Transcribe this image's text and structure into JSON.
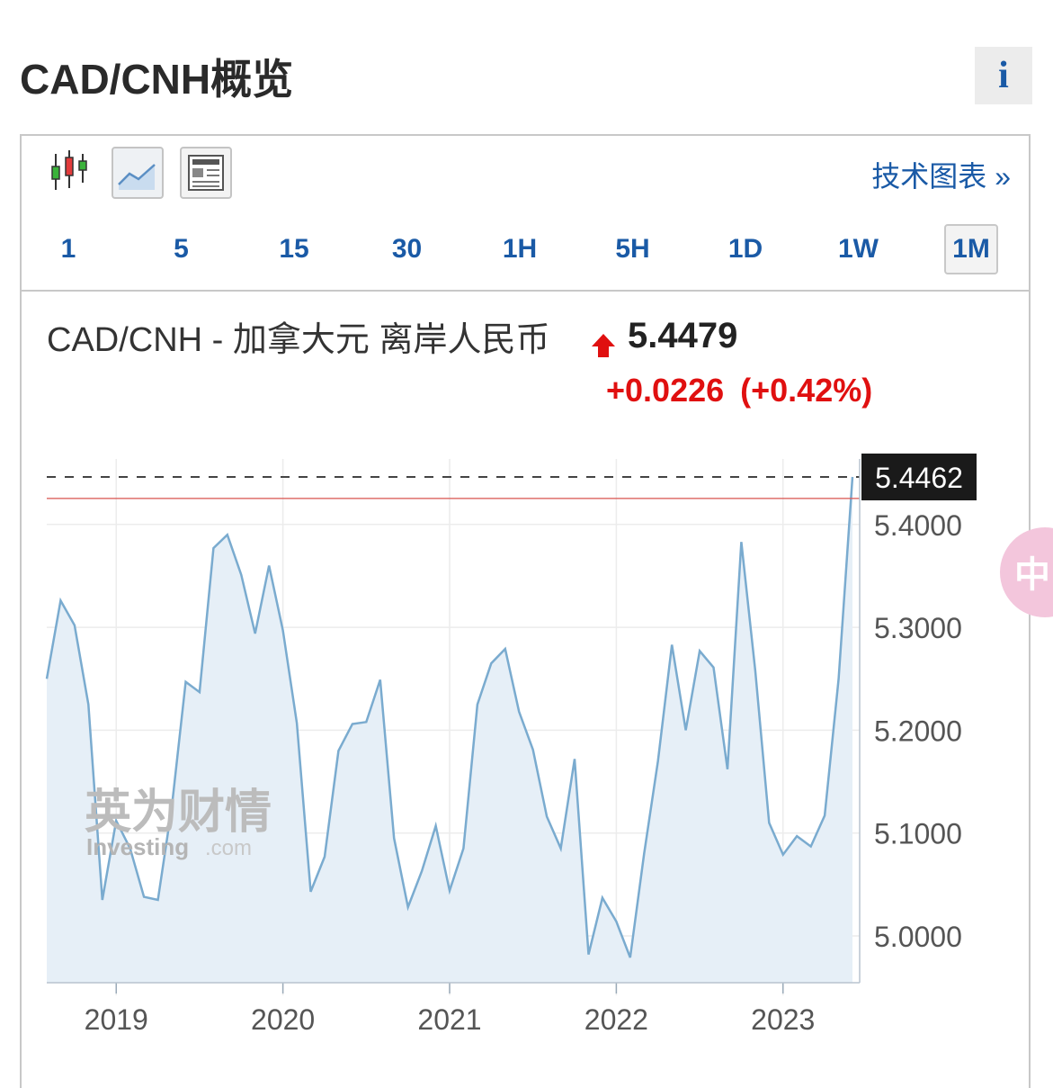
{
  "page": {
    "title": "CAD/CNH概览",
    "info_label": "i"
  },
  "toolbar": {
    "chart_types": [
      {
        "name": "candlestick-chart-icon",
        "active": false
      },
      {
        "name": "area-chart-icon",
        "active": true
      },
      {
        "name": "overview-table-icon",
        "active": false
      }
    ],
    "tech_link": "技术图表 »"
  },
  "timeframes": [
    {
      "label": "1",
      "active": false
    },
    {
      "label": "5",
      "active": false
    },
    {
      "label": "15",
      "active": false
    },
    {
      "label": "30",
      "active": false
    },
    {
      "label": "1H",
      "active": false
    },
    {
      "label": "5H",
      "active": false
    },
    {
      "label": "1D",
      "active": false
    },
    {
      "label": "1W",
      "active": false
    },
    {
      "label": "1M",
      "active": true
    }
  ],
  "instrument": {
    "name": "CAD/CNH - 加拿大元 离岸人民币",
    "last_price": "5.4479",
    "change": "+0.0226",
    "change_pct": "(+0.42%)",
    "direction": "up"
  },
  "watermark": {
    "brand": "英为财情",
    "sub": "Investing",
    "domain": ".com"
  },
  "side_badge": "中",
  "colors": {
    "link": "#1a5aa6",
    "up": "#e01010",
    "line": "#7aabcf",
    "area_fill": "#e6eff7",
    "ref_line": "#d9534f",
    "label_bg": "#1a1a1a"
  },
  "chart_data": {
    "type": "area",
    "title": "",
    "xlabel": "",
    "ylabel": "",
    "x_ticks": [
      "2019",
      "2020",
      "2021",
      "2022",
      "2023"
    ],
    "y_ticks": [
      "5.0000",
      "5.1000",
      "5.2000",
      "5.3000",
      "5.4000"
    ],
    "ylim": [
      4.96,
      5.47
    ],
    "current_value": 5.4462,
    "current_label": "5.4462",
    "reference_value": 5.4253,
    "grid": true,
    "series": [
      {
        "x": [
          "2018-08",
          "2018-09",
          "2018-10",
          "2018-11",
          "2018-12",
          "2019-01",
          "2019-02",
          "2019-03",
          "2019-04",
          "2019-05",
          "2019-06",
          "2019-07",
          "2019-08",
          "2019-09",
          "2019-10",
          "2019-11",
          "2019-12",
          "2020-01",
          "2020-02",
          "2020-03",
          "2020-04",
          "2020-05",
          "2020-06",
          "2020-07",
          "2020-08",
          "2020-09",
          "2020-10",
          "2020-11",
          "2020-12",
          "2021-01",
          "2021-02",
          "2021-03",
          "2021-04",
          "2021-05",
          "2021-06",
          "2021-07",
          "2021-08",
          "2021-09",
          "2021-10",
          "2021-11",
          "2021-12",
          "2022-01",
          "2022-02",
          "2022-03",
          "2022-04",
          "2022-05",
          "2022-06",
          "2022-07",
          "2022-08",
          "2022-09",
          "2022-10",
          "2022-11",
          "2022-12",
          "2023-01",
          "2023-02",
          "2023-03",
          "2023-04",
          "2023-05",
          "2023-06"
        ],
        "values": [
          5.25,
          5.326,
          5.302,
          5.225,
          5.035,
          5.112,
          5.085,
          5.038,
          5.035,
          5.125,
          5.247,
          5.237,
          5.377,
          5.39,
          5.351,
          5.294,
          5.36,
          5.297,
          5.207,
          5.043,
          5.077,
          5.18,
          5.206,
          5.208,
          5.249,
          5.095,
          5.028,
          5.063,
          5.107,
          5.044,
          5.085,
          5.225,
          5.265,
          5.279,
          5.218,
          5.181,
          5.116,
          5.085,
          5.172,
          4.982,
          5.037,
          5.014,
          4.979,
          5.08,
          5.17,
          5.283,
          5.2,
          5.277,
          5.261,
          5.162,
          5.383,
          5.258,
          5.11,
          5.079,
          5.097,
          5.087,
          5.117,
          5.25,
          5.4462
        ]
      }
    ]
  }
}
